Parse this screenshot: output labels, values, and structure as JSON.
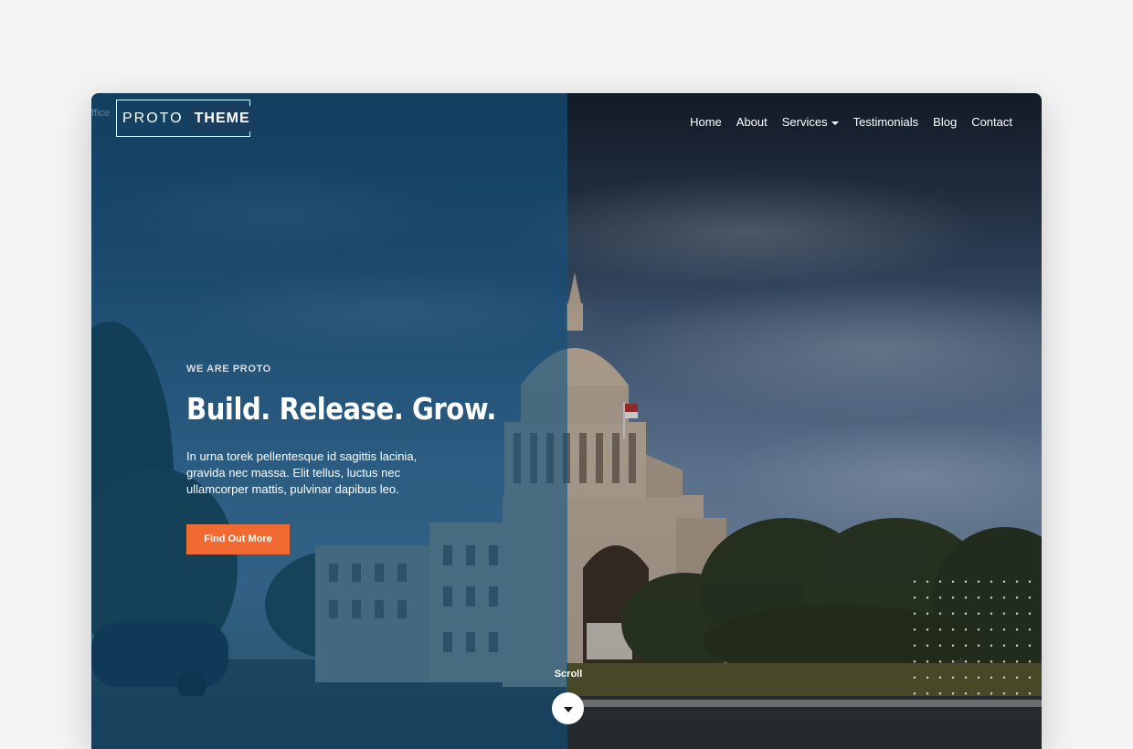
{
  "header": {
    "ghost_text": "ffice",
    "logo": {
      "word1": "PROTO",
      "word2": "THEME"
    },
    "nav": [
      {
        "label": "Home"
      },
      {
        "label": "About"
      },
      {
        "label": "Services",
        "has_dropdown": true
      },
      {
        "label": "Testimonials"
      },
      {
        "label": "Blog"
      },
      {
        "label": "Contact"
      }
    ]
  },
  "hero": {
    "eyebrow": "WE ARE PROTO",
    "headline": "Build. Release. Grow.",
    "description": "In urna torek pellentesque id sagittis lacinia, gravida nec massa. Elit tellus, luctus nec ullamcorper mattis, pulvinar dapibus leo.",
    "cta_label": "Find Out More"
  },
  "scroll": {
    "label": "Scroll"
  },
  "colors": {
    "page_bg": "#f4f4f4",
    "overlay_left": "#0d4870",
    "cta": "#f06a32",
    "text": "#ffffff"
  }
}
